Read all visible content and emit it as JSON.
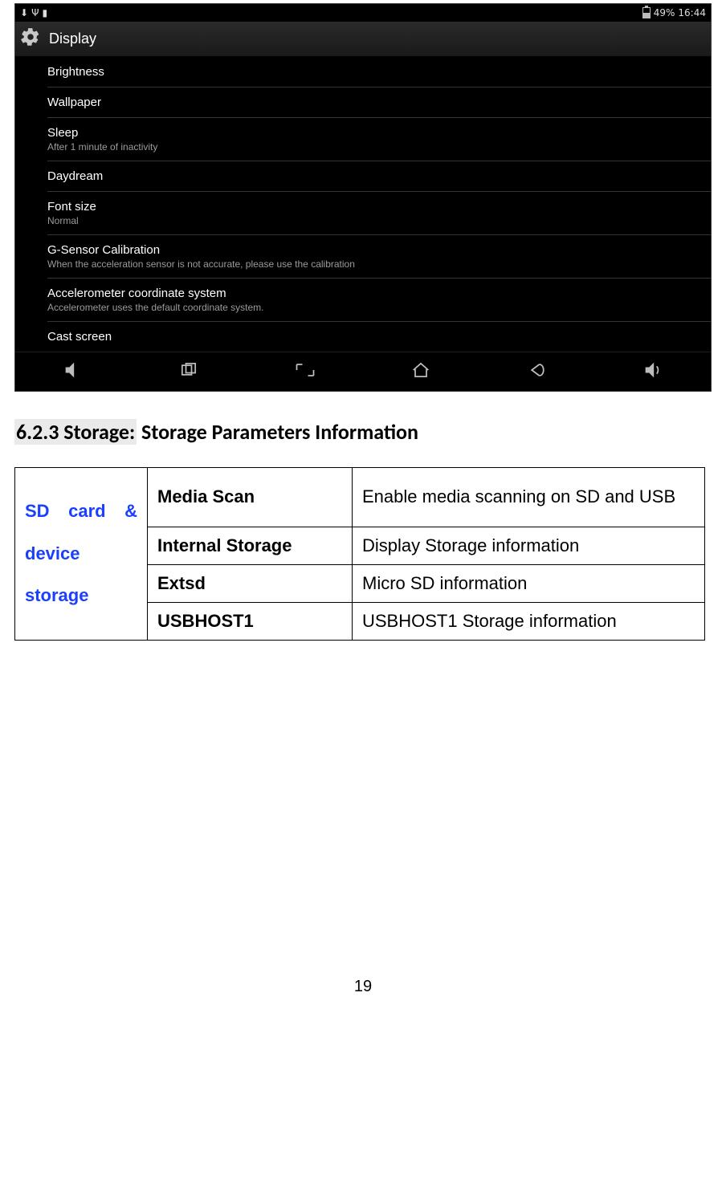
{
  "statusbar": {
    "battery_pct": "49%",
    "clock": "16:44"
  },
  "appbar": {
    "title": "Display"
  },
  "settings_items": [
    {
      "title": "Brightness",
      "sub": ""
    },
    {
      "title": "Wallpaper",
      "sub": ""
    },
    {
      "title": "Sleep",
      "sub": "After 1 minute of inactivity"
    },
    {
      "title": "Daydream",
      "sub": ""
    },
    {
      "title": "Font size",
      "sub": "Normal"
    },
    {
      "title": "G-Sensor Calibration",
      "sub": "When the acceleration sensor is not accurate, please use the calibration"
    },
    {
      "title": "Accelerometer coordinate system",
      "sub": "Accelerometer uses the default coordinate system."
    },
    {
      "title": "Cast screen",
      "sub": ""
    }
  ],
  "heading": {
    "prefix": "6.2.3 Storage:",
    "rest": " Storage Parameters Information"
  },
  "table": {
    "rowhead": "SD card & device storage",
    "rows": [
      {
        "param": "Media Scan",
        "desc": "Enable media scanning on SD and USB"
      },
      {
        "param": "Internal Storage",
        "desc": "Display Storage information"
      },
      {
        "param": "Extsd",
        "desc": "Micro SD information"
      },
      {
        "param": "USBHOST1",
        "desc": "USBHOST1 Storage information"
      }
    ]
  },
  "page_number": "19"
}
